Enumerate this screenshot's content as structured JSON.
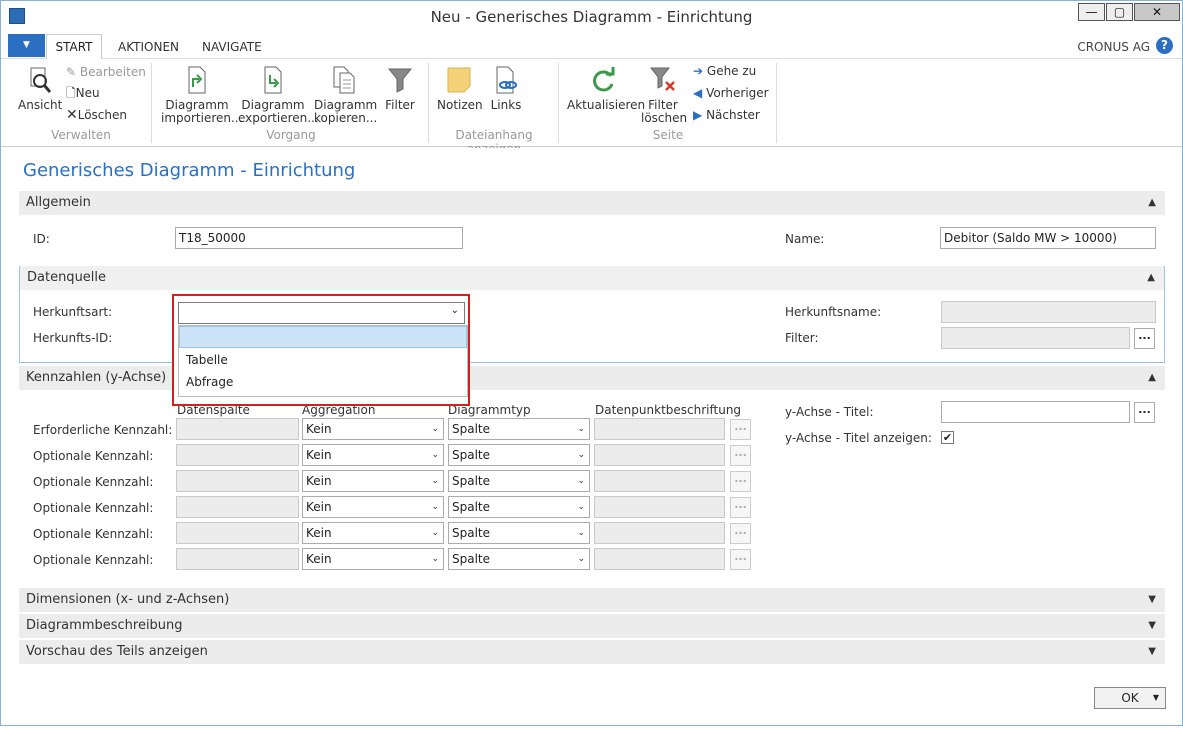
{
  "window": {
    "title": "Neu - Generisches Diagramm - Einrichtung",
    "min_glyph": "—",
    "max_glyph": "▢",
    "close_glyph": "✕"
  },
  "tabs": [
    "START",
    "AKTIONEN",
    "NAVIGATE"
  ],
  "company": "CRONUS AG",
  "help_glyph": "?",
  "ribbon": {
    "groups": {
      "verwalten": "Verwalten",
      "vorgang": "Vorgang",
      "dateianhang": "Dateianhang anzeigen",
      "seite": "Seite"
    },
    "ansicht": "Ansicht",
    "bearbeiten": "Bearbeiten",
    "neu": "Neu",
    "loeschen": "Löschen",
    "diagramm_importieren": [
      "Diagramm",
      "importieren..."
    ],
    "diagramm_exportieren": [
      "Diagramm",
      "exportieren..."
    ],
    "diagramm_kopieren": [
      "Diagramm",
      "kopieren..."
    ],
    "filter": "Filter",
    "notizen": "Notizen",
    "links": "Links",
    "aktualisieren": "Aktualisieren",
    "filter_loeschen": [
      "Filter",
      "löschen"
    ],
    "gehe_zu": "Gehe zu",
    "vorheriger": "Vorheriger",
    "naechster": "Nächster"
  },
  "page_title": "Generisches Diagramm - Einrichtung",
  "allgemein": {
    "header": "Allgemein",
    "id_label": "ID:",
    "id_value": "T18_50000",
    "name_label": "Name:",
    "name_value": "Debitor (Saldo MW > 10000)"
  },
  "datenquelle": {
    "header": "Datenquelle",
    "herkunftsart_label": "Herkunftsart:",
    "herkunftsid_label": "Herkunfts-ID:",
    "herkunftsname_label": "Herkunftsname:",
    "filter_label": "Filter:",
    "dropdown_options": [
      "",
      "Tabelle",
      "Abfrage"
    ]
  },
  "kennzahlen": {
    "header": "Kennzahlen (y-Achse)",
    "col_datenspalte": "Datenspalte",
    "col_aggregation": "Aggregation",
    "col_diagrammtyp": "Diagrammtyp",
    "col_datenpunkt": "Datenpunktbeschriftung",
    "rows": [
      {
        "label": "Erforderliche Kennzahl:",
        "aggregation": "Kein",
        "typ": "Spalte"
      },
      {
        "label": "Optionale Kennzahl:",
        "aggregation": "Kein",
        "typ": "Spalte"
      },
      {
        "label": "Optionale Kennzahl:",
        "aggregation": "Kein",
        "typ": "Spalte"
      },
      {
        "label": "Optionale Kennzahl:",
        "aggregation": "Kein",
        "typ": "Spalte"
      },
      {
        "label": "Optionale Kennzahl:",
        "aggregation": "Kein",
        "typ": "Spalte"
      },
      {
        "label": "Optionale Kennzahl:",
        "aggregation": "Kein",
        "typ": "Spalte"
      }
    ],
    "y_titel_label": "y-Achse - Titel:",
    "y_titel_anzeigen_label": "y-Achse - Titel anzeigen:",
    "y_titel_anzeigen_checked": true
  },
  "dimensionen": {
    "header": "Dimensionen (x- und z-Achsen)"
  },
  "diagrammbeschreibung": {
    "header": "Diagrammbeschreibung"
  },
  "vorschau": {
    "header": "Vorschau des Teils anzeigen"
  },
  "ok_label": "OK",
  "ellipsis": "...",
  "checkmark": "✔",
  "colors": {
    "accent": "#2a6fc2",
    "highlight_border": "#d02020",
    "selected_option": "#cde3f7"
  }
}
